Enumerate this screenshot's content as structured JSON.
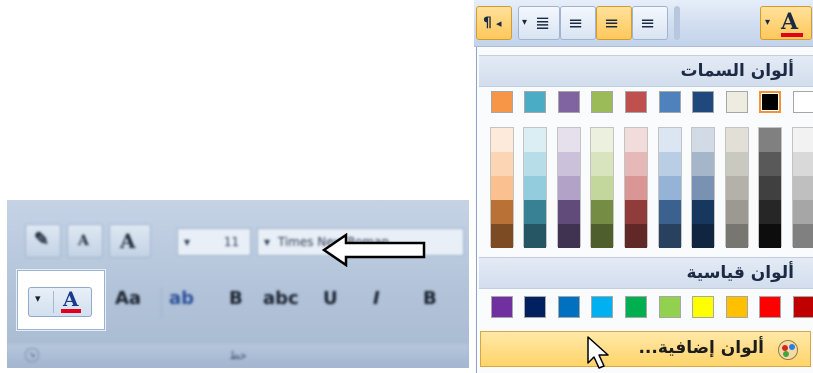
{
  "left_panel": {
    "font_name_value": "Times New Roman",
    "font_size_value": "11",
    "group_label": "خط",
    "font_color_button": {
      "letter": "A",
      "underline_color": "#e0001b"
    }
  },
  "toolbar": {
    "font_color_letter": "A",
    "paragraph_mark": "¶"
  },
  "menu": {
    "theme_colors_label": "ألوان السمات",
    "standard_colors_label": "ألوان قياسية",
    "more_colors_label": "ألوان إضافية...",
    "theme_colors": [
      "#ffffff",
      "#000000",
      "#eeece1",
      "#1f497d",
      "#4f81bd",
      "#c0504d",
      "#9bbb59",
      "#8064a2",
      "#4bacc6",
      "#f79646"
    ],
    "standard_colors": [
      "#c00000",
      "#ff0000",
      "#ffc000",
      "#ffff00",
      "#92d050",
      "#00b050",
      "#00b0f0",
      "#0070c0",
      "#002060",
      "#7030a0"
    ],
    "selected_theme_color": "#000000"
  },
  "colors": {
    "ribbon_bg": "#b2c3d9",
    "highlight": "#ffd46a",
    "header_bg": "#d2dded"
  }
}
